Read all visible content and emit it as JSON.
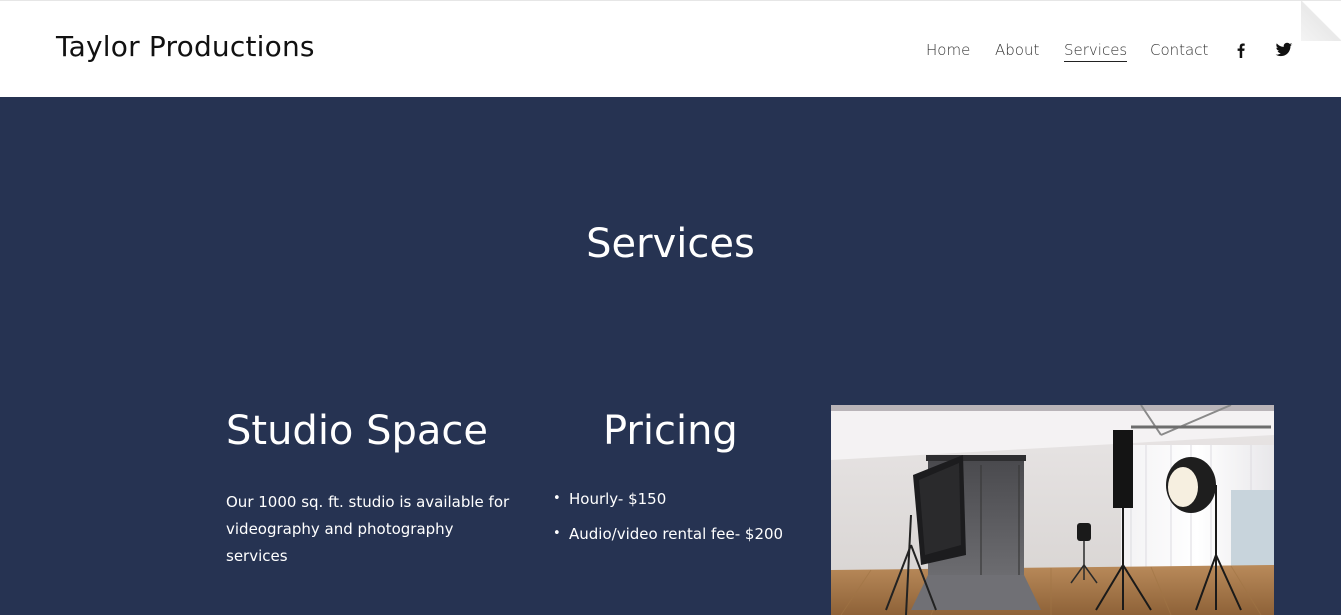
{
  "header": {
    "site_title": "Taylor Productions",
    "nav": {
      "home": "Home",
      "about": "About",
      "services": "Services",
      "contact": "Contact"
    },
    "social": {
      "facebook_icon": "facebook-icon",
      "twitter_icon": "twitter-icon"
    }
  },
  "main": {
    "page_title": "Services",
    "studio": {
      "heading": "Studio Space",
      "description": "Our 1000 sq. ft. studio is available for videography and photography services"
    },
    "pricing": {
      "heading": "Pricing",
      "items": [
        "Hourly- $150",
        "Audio/video rental fee- $200"
      ]
    },
    "image": {
      "subject": "photo studio with softbox lights and grey backdrop"
    }
  },
  "colors": {
    "header_bg": "#ffffff",
    "main_bg": "#263352",
    "text_light": "#ffffff",
    "text_dark": "#111111"
  }
}
